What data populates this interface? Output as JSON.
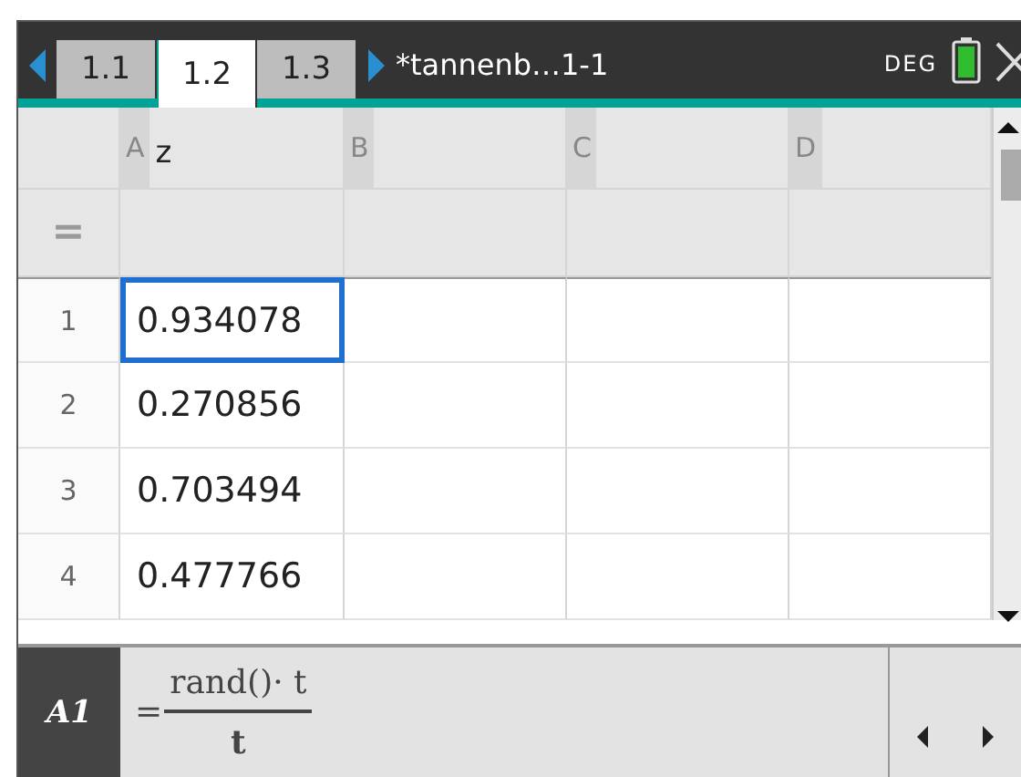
{
  "tabs": [
    {
      "label": "1.1",
      "selected": false
    },
    {
      "label": "1.2",
      "selected": true
    },
    {
      "label": "1.3",
      "selected": false
    }
  ],
  "document_title": "*tannenb…1-1",
  "angle_mode": "DEG",
  "columns": [
    {
      "letter": "A",
      "name": "z"
    },
    {
      "letter": "B"
    },
    {
      "letter": "C"
    },
    {
      "letter": "D"
    }
  ],
  "formula_row_symbol": "=",
  "rows": [
    {
      "number": "1",
      "value": "0.934078",
      "selected": true
    },
    {
      "number": "2",
      "value": "0.270856",
      "selected": false
    },
    {
      "number": "3",
      "value": "0.703494",
      "selected": false
    },
    {
      "number": "4",
      "value": "0.477766",
      "selected": false
    }
  ],
  "entry_line": {
    "cell": "A1",
    "equals": "=",
    "numerator": "rand()· t",
    "denominator": "t"
  }
}
